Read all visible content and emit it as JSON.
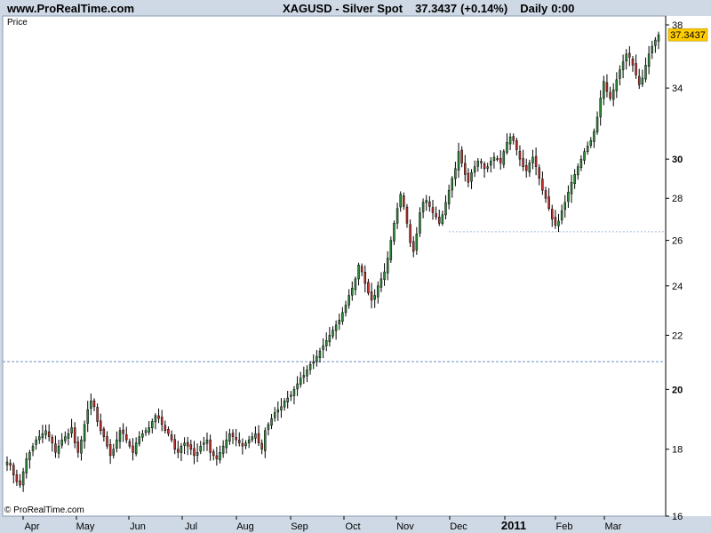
{
  "header": {
    "site": "www.ProRealTime.com",
    "symbol": "XAGUSD - Silver Spot",
    "last": "37.3437",
    "change": "(+0.14%)",
    "period": "Daily",
    "time": "0:00"
  },
  "pane_label": "Price",
  "copyright": "© ProRealTime.com",
  "colors": {
    "background": "#ffffff",
    "frame": "#cfd9e6",
    "up": "#2e8b3a",
    "down": "#c0322d",
    "wick": "#000000",
    "ref_line": "#6a8fc7",
    "price_marker": "#ffcc00"
  },
  "chart_data": {
    "type": "candlestick",
    "scale": "log",
    "ylim": [
      16,
      38.6
    ],
    "y_ticks": [
      16,
      18,
      20,
      22,
      24,
      26,
      28,
      30,
      34,
      38
    ],
    "y_ticks_bold": [
      20,
      30
    ],
    "x_labels": [
      "Apr",
      "May",
      "Jun",
      "Jul",
      "Aug",
      "Sep",
      "Oct",
      "Nov",
      "Dec",
      "2011",
      "Feb",
      "Mar"
    ],
    "x_labels_bold": [
      "2011"
    ],
    "last_price": 37.3437,
    "last_price_label": "37.3437",
    "reference_lines": [
      21.0,
      26.4
    ],
    "closes": [
      17.6,
      17.5,
      17.2,
      17.0,
      16.9,
      17.3,
      17.7,
      17.9,
      18.1,
      18.3,
      18.4,
      18.5,
      18.6,
      18.4,
      18.2,
      17.9,
      18.1,
      18.3,
      18.4,
      18.5,
      18.7,
      18.2,
      17.9,
      18.3,
      18.8,
      19.3,
      19.6,
      19.4,
      18.9,
      18.6,
      18.4,
      18.1,
      17.8,
      18.0,
      18.3,
      18.6,
      18.5,
      18.3,
      18.1,
      17.9,
      18.2,
      18.4,
      18.5,
      18.6,
      18.7,
      18.9,
      19.1,
      19.0,
      18.8,
      18.6,
      18.5,
      18.3,
      18.0,
      17.9,
      18.1,
      18.2,
      18.1,
      18.0,
      17.8,
      17.9,
      18.1,
      18.2,
      18.3,
      17.9,
      17.8,
      17.7,
      17.9,
      18.1,
      18.3,
      18.5,
      18.4,
      18.3,
      18.2,
      18.1,
      18.2,
      18.3,
      18.4,
      18.5,
      18.2,
      18.0,
      18.6,
      18.8,
      19.0,
      19.2,
      19.3,
      19.4,
      19.6,
      19.7,
      19.8,
      20.0,
      20.2,
      20.4,
      20.5,
      20.7,
      20.9,
      21.0,
      21.2,
      21.4,
      21.6,
      21.8,
      22.0,
      22.2,
      22.4,
      22.6,
      22.9,
      23.2,
      23.6,
      23.9,
      24.3,
      24.9,
      24.6,
      24.1,
      23.7,
      23.4,
      23.6,
      24.0,
      24.3,
      24.6,
      25.2,
      26.0,
      26.8,
      27.5,
      28.2,
      27.6,
      26.8,
      25.9,
      25.5,
      26.3,
      27.3,
      27.8,
      27.9,
      27.6,
      27.3,
      27.1,
      26.8,
      27.2,
      27.8,
      28.4,
      29.0,
      29.5,
      30.4,
      29.8,
      29.2,
      28.8,
      29.3,
      29.6,
      29.9,
      29.8,
      29.5,
      29.6,
      29.9,
      30.1,
      30.0,
      29.8,
      30.4,
      30.9,
      31.2,
      31.0,
      30.5,
      30.0,
      29.6,
      29.4,
      29.8,
      30.1,
      29.6,
      29.0,
      28.4,
      28.0,
      27.5,
      27.0,
      26.7,
      26.9,
      27.4,
      27.8,
      28.3,
      28.8,
      29.2,
      29.6,
      30.0,
      30.4,
      30.7,
      31.0,
      31.5,
      32.3,
      33.4,
      34.4,
      33.8,
      33.4,
      33.9,
      34.5,
      35.1,
      35.6,
      36.1,
      35.9,
      35.4,
      34.8,
      34.2,
      34.6,
      35.4,
      36.1,
      36.6,
      37.0,
      37.34
    ]
  }
}
